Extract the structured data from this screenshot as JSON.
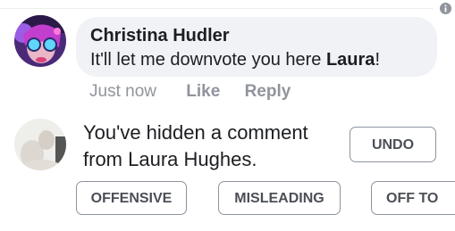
{
  "comment": {
    "author": "Christina Hudler",
    "text_before": "It'll let me downvote you here ",
    "text_bold": "Laura",
    "text_after": "!",
    "time": "Just now",
    "like_label": "Like",
    "reply_label": "Reply"
  },
  "hidden_comment": {
    "line1": "You've hidden a comment",
    "line2": "from Laura Hughes.",
    "undo_label": "UNDO",
    "reasons": [
      "OFFENSIVE",
      "MISLEADING",
      "OFF TO"
    ]
  },
  "icons": {
    "info": "info-icon"
  },
  "colors": {
    "bubble_bg": "#f0f2f5",
    "meta_text": "#90949c",
    "button_border": "#8d949e",
    "button_text": "#4b4f56"
  }
}
